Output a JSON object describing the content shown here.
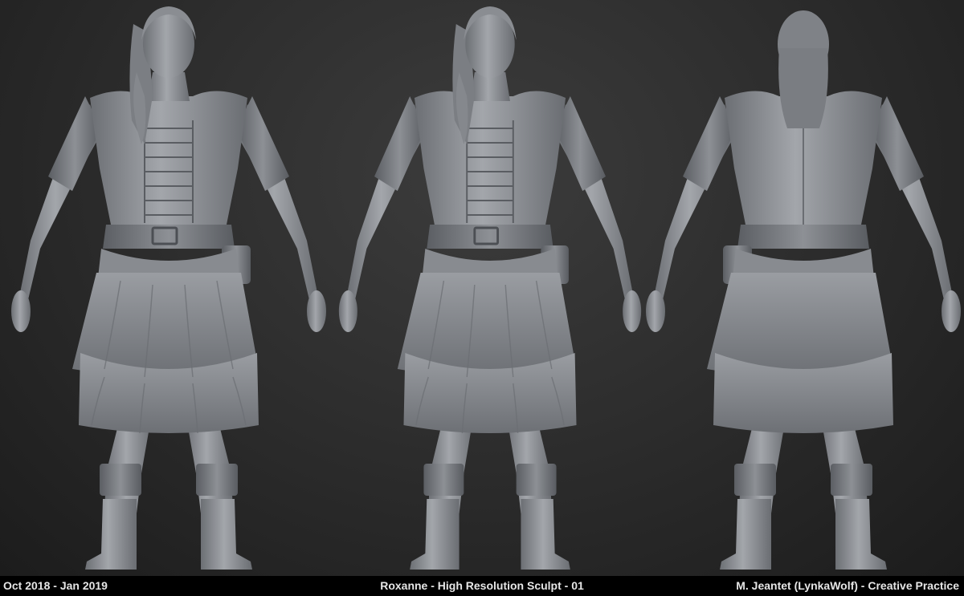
{
  "footer": {
    "date_range": "Oct 2018 - Jan 2019",
    "title": "Roxanne - High Resolution Sculpt - 01",
    "credit": "M. Jeantet (LynkaWolf) - Creative Practice"
  },
  "render": {
    "views": [
      "front",
      "three-quarter",
      "back"
    ],
    "clay_color": "#8e9196",
    "background_color": "#2e2e2e",
    "footer_background": "#000000"
  }
}
